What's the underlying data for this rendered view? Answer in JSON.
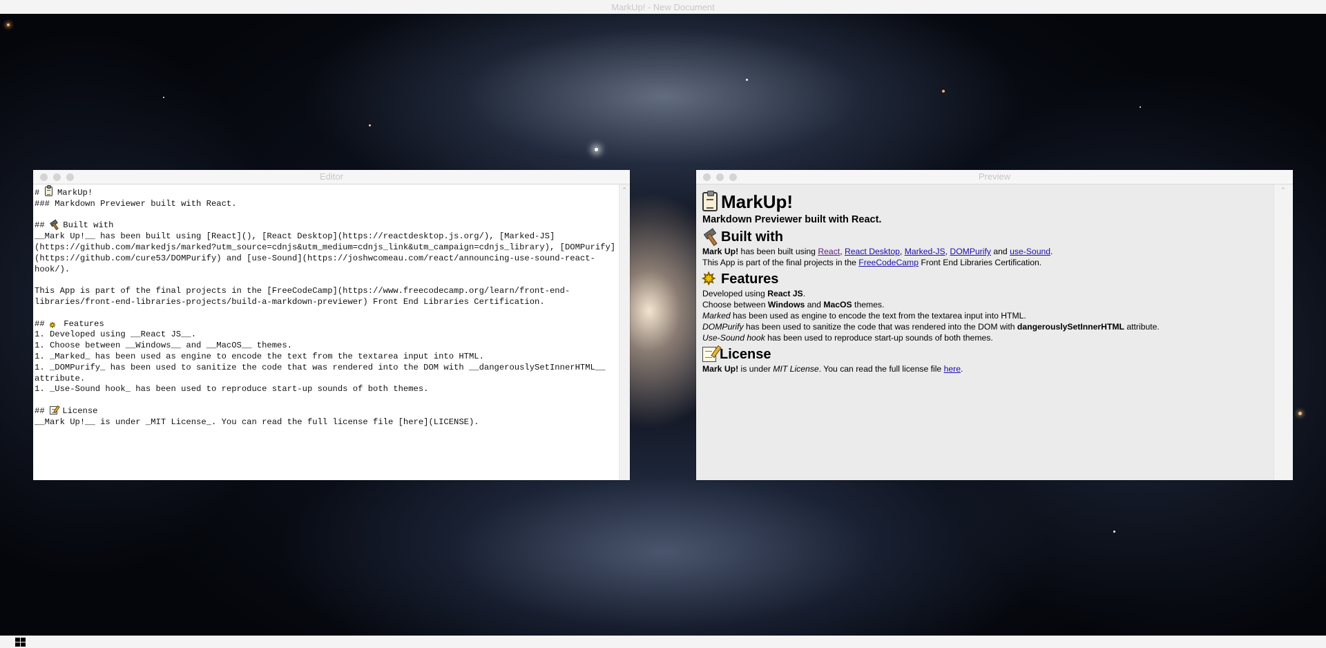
{
  "app": {
    "title": "MarkUp! - New Document"
  },
  "editor": {
    "title": "Editor",
    "lines": [
      {
        "prefix": "# ",
        "icon": "clipboard-icon",
        "text": " MarkUp!"
      },
      {
        "text": "### Markdown Previewer built with React."
      },
      {
        "text": ""
      },
      {
        "prefix": "## ",
        "icon": "hammer-icon",
        "text": " Built with"
      },
      {
        "text": "__Mark Up!__ has been built using [React](), [React Desktop](https://reactdesktop.js.org/), [Marked-JS](https://github.com/markedjs/marked?utm_source=cdnjs&utm_medium=cdnjs_link&utm_campaign=cdnjs_library), [DOMPurify](https://github.com/cure53/DOMPurify) and [use-Sound](https://joshwcomeau.com/react/announcing-use-sound-react-hook/)."
      },
      {
        "text": ""
      },
      {
        "text": "This App is part of the final projects in the [FreeCodeCamp](https://www.freecodecamp.org/learn/front-end-libraries/front-end-libraries-projects/build-a-markdown-previewer) Front End Libraries Certification."
      },
      {
        "text": ""
      },
      {
        "prefix": "## ",
        "icon": "sparkle-icon",
        "text": " Features"
      },
      {
        "text": "1. Developed using __React JS__."
      },
      {
        "text": "1. Choose between __Windows__ and __MacOS__ themes."
      },
      {
        "text": "1. _Marked_ has been used as engine to encode the text from the textarea input into HTML."
      },
      {
        "text": "1. _DOMPurify_ has been used to sanitize the code that was rendered into the DOM with __dangerouslySetInnerHTML__ attribute."
      },
      {
        "text": "1. _Use-Sound hook_ has been used to reproduce start-up sounds of both themes."
      },
      {
        "text": ""
      },
      {
        "prefix": "## ",
        "icon": "memo-icon",
        "text": " License"
      },
      {
        "text": "__Mark Up!__ is under _MIT License_. You can read the full license file [here](LICENSE)."
      }
    ]
  },
  "preview": {
    "title": "Preview",
    "h1": "MarkUp!",
    "subtitle": "Markdown Previewer built with React.",
    "built_with": {
      "heading": "Built with",
      "name": "Mark Up!",
      "text_a": " has been built using ",
      "links": [
        "React",
        "React Desktop",
        "Marked-JS",
        "DOMPurify",
        "use-Sound"
      ],
      "sep1": ", ",
      "sep2": ", ",
      "sep3": ", ",
      "sep4": " and ",
      "end": ".",
      "line2_a": "This App is part of the final projects in the ",
      "line2_link": "FreeCodeCamp",
      "line2_b": " Front End Libraries Certification."
    },
    "features": {
      "heading": "Features",
      "f1_a": "Developed using ",
      "f1_b": "React JS",
      "f1_c": ".",
      "f2_a": "Choose between ",
      "f2_b": "Windows",
      "f2_c": " and ",
      "f2_d": "MacOS",
      "f2_e": " themes.",
      "f3_a": "Marked",
      "f3_b": " has been used as engine to encode the text from the textarea input into HTML.",
      "f4_a": "DOMPurify",
      "f4_b": " has been used to sanitize the code that was rendered into the DOM with ",
      "f4_c": "dangerouslySetInnerHTML",
      "f4_d": " attribute.",
      "f5_a": "Use-Sound hook",
      "f5_b": " has been used to reproduce start-up sounds of both themes."
    },
    "license": {
      "heading": "License",
      "name": "Mark Up!",
      "text_a": " is under ",
      "mit": "MIT License",
      "text_b": ". You can read the full license file ",
      "link": "here",
      "end": "."
    }
  },
  "colors": {
    "link": "#1a0dab",
    "visited_link": "#5a1a7a",
    "preview_bg": "#ebebeb"
  }
}
